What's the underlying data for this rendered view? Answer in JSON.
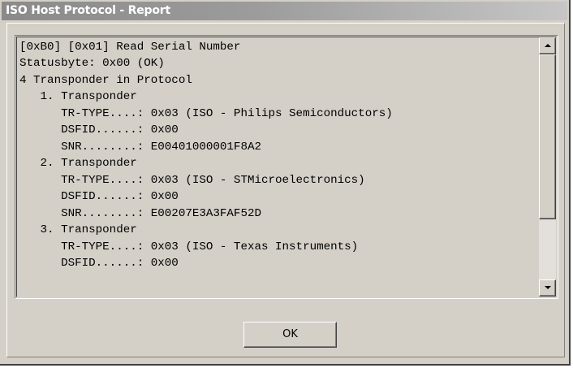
{
  "window": {
    "title": "ISO Host Protocol - Report"
  },
  "report": {
    "lines": [
      "[0xB0] [0x01] Read Serial Number",
      "Statusbyte: 0x00 (OK)",
      "4 Transponder in Protocol",
      "   1. Transponder",
      "      TR-TYPE....: 0x03 (ISO - Philips Semiconductors)",
      "      DSFID......: 0x00",
      "      SNR........: E00401000001F8A2",
      "   2. Transponder",
      "      TR-TYPE....: 0x03 (ISO - STMicroelectronics)",
      "      DSFID......: 0x00",
      "      SNR........: E00207E3A3FAF52D",
      "   3. Transponder",
      "      TR-TYPE....: 0x03 (ISO - Texas Instruments)",
      "      DSFID......: 0x00"
    ]
  },
  "buttons": {
    "ok_label": "OK"
  },
  "icons": {
    "scroll_up": "triangle-up-icon",
    "scroll_down": "triangle-down-icon"
  },
  "colors": {
    "face": "#d4d0c8",
    "title_gradient_start": "#8a8a8a",
    "title_gradient_end": "#c6c6c6",
    "title_text": "#ffffff"
  }
}
